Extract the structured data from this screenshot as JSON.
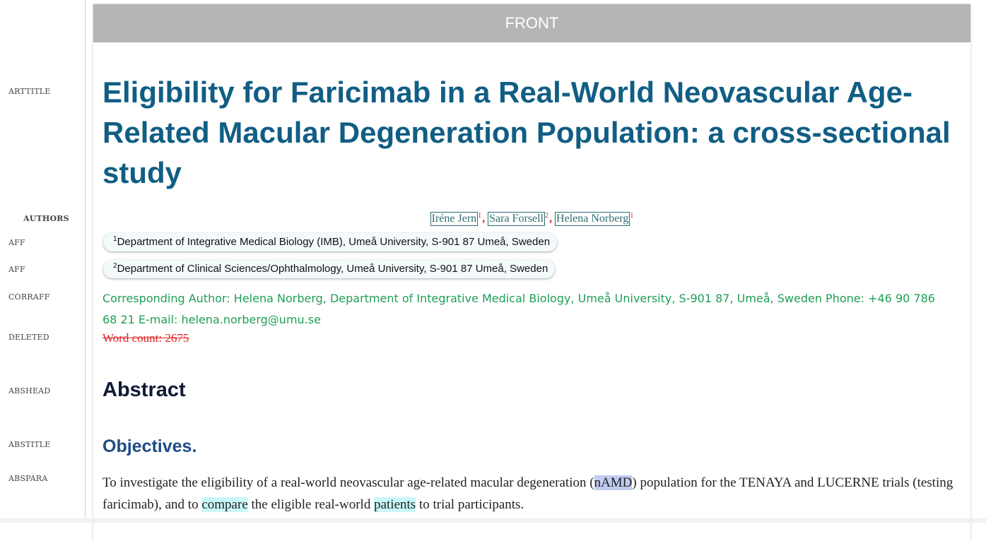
{
  "gutter_labels": {
    "arttitle": "ARTTITLE",
    "authors": "AUTHORS",
    "aff_1": "AFF",
    "aff_2": "AFF",
    "corraff": "CORRAFF",
    "deleted": "DELETED",
    "abshead": "ABSHEAD",
    "abstitle": "ABSTITLE",
    "abspara": "ABSPARA"
  },
  "section_header": "FRONT",
  "article_title": "Eligibility for Faricimab in a Real-World Neovascular Age-Related Macular Degeneration Population: a cross-sectional study",
  "authors": [
    {
      "name": "Iréne Jern",
      "aff": "1"
    },
    {
      "name": "Sara Forsell",
      "aff": "2"
    },
    {
      "name": "Helena Norberg",
      "aff": "1"
    }
  ],
  "author_separator": ",",
  "affiliations": [
    {
      "num": "1",
      "text": "Department of Integrative Medical Biology (IMB), Umeå University, S-901 87 Umeå, Sweden"
    },
    {
      "num": "2",
      "text": "Department of Clinical Sciences/Ophthalmology, Umeå University, S-901 87 Umeå, Sweden"
    }
  ],
  "corresponding_author": "Corresponding Author: Helena Norberg, Department of Integrative Medical Biology, Umeå University, S-901 87, Umeå, Sweden Phone: +46 90 786 68 21 E-mail: helena.norberg@umu.se",
  "deleted_text": "Word count: 2675",
  "abstract_heading": "Abstract",
  "abstract_subtitle": "Objectives.",
  "abstract_paragraph": {
    "t1": "To investigate the eligibility of a real-world neovascular age-related macular degeneration (",
    "hl1": "nAMD",
    "t2": ") population for the TENAYA and LUCERNE trials (testing faricimab), and to ",
    "hl2": "compare",
    "t3": " the eligible real-world ",
    "hl3": "patients",
    "t4": " to trial participants."
  },
  "colors": {
    "title": "#115e84",
    "corresponding": "#1e9e57",
    "deleted": "#e02424",
    "highlight_term": "#c0ccef",
    "highlight_word": "#c9f7f7"
  }
}
